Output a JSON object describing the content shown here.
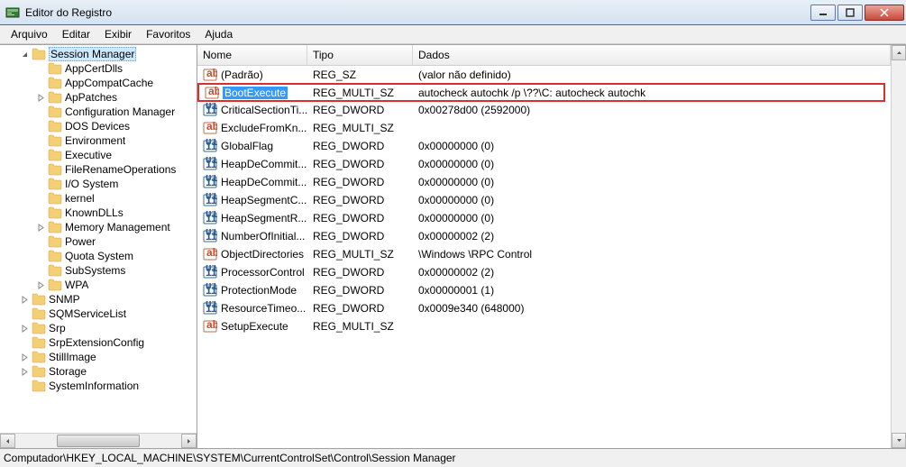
{
  "window": {
    "title": "Editor do Registro"
  },
  "menu": {
    "arquivo": "Arquivo",
    "editar": "Editar",
    "exibir": "Exibir",
    "favoritos": "Favoritos",
    "ajuda": "Ajuda"
  },
  "tree": {
    "items": [
      {
        "label": "Session Manager",
        "depth": 1,
        "expanded": true,
        "selected": true
      },
      {
        "label": "AppCertDlls",
        "depth": 2
      },
      {
        "label": "AppCompatCache",
        "depth": 2
      },
      {
        "label": "ApPatches",
        "depth": 2,
        "expander": "closed"
      },
      {
        "label": "Configuration Manager",
        "depth": 2
      },
      {
        "label": "DOS Devices",
        "depth": 2
      },
      {
        "label": "Environment",
        "depth": 2
      },
      {
        "label": "Executive",
        "depth": 2
      },
      {
        "label": "FileRenameOperations",
        "depth": 2
      },
      {
        "label": "I/O System",
        "depth": 2
      },
      {
        "label": "kernel",
        "depth": 2
      },
      {
        "label": "KnownDLLs",
        "depth": 2
      },
      {
        "label": "Memory Management",
        "depth": 2,
        "expander": "closed"
      },
      {
        "label": "Power",
        "depth": 2
      },
      {
        "label": "Quota System",
        "depth": 2
      },
      {
        "label": "SubSystems",
        "depth": 2
      },
      {
        "label": "WPA",
        "depth": 2,
        "expander": "closed"
      },
      {
        "label": "SNMP",
        "depth": 1,
        "expander": "closed"
      },
      {
        "label": "SQMServiceList",
        "depth": 1
      },
      {
        "label": "Srp",
        "depth": 1,
        "expander": "closed"
      },
      {
        "label": "SrpExtensionConfig",
        "depth": 1
      },
      {
        "label": "StillImage",
        "depth": 1,
        "expander": "closed"
      },
      {
        "label": "Storage",
        "depth": 1,
        "expander": "closed"
      },
      {
        "label": "SystemInformation",
        "depth": 1
      }
    ]
  },
  "list": {
    "columns": {
      "name": "Nome",
      "type": "Tipo",
      "data": "Dados"
    },
    "rows": [
      {
        "kind": "sz",
        "name": "(Padrão)",
        "type": "REG_SZ",
        "data": "(valor não definido)"
      },
      {
        "kind": "sz",
        "name": "BootExecute",
        "type": "REG_MULTI_SZ",
        "data": "autocheck autochk /p \\??\\C: autocheck autochk",
        "selected": true,
        "highlighted": true
      },
      {
        "kind": "dw",
        "name": "CriticalSectionTi...",
        "type": "REG_DWORD",
        "data": "0x00278d00 (2592000)"
      },
      {
        "kind": "sz",
        "name": "ExcludeFromKn...",
        "type": "REG_MULTI_SZ",
        "data": ""
      },
      {
        "kind": "dw",
        "name": "GlobalFlag",
        "type": "REG_DWORD",
        "data": "0x00000000 (0)"
      },
      {
        "kind": "dw",
        "name": "HeapDeCommit...",
        "type": "REG_DWORD",
        "data": "0x00000000 (0)"
      },
      {
        "kind": "dw",
        "name": "HeapDeCommit...",
        "type": "REG_DWORD",
        "data": "0x00000000 (0)"
      },
      {
        "kind": "dw",
        "name": "HeapSegmentC...",
        "type": "REG_DWORD",
        "data": "0x00000000 (0)"
      },
      {
        "kind": "dw",
        "name": "HeapSegmentR...",
        "type": "REG_DWORD",
        "data": "0x00000000 (0)"
      },
      {
        "kind": "dw",
        "name": "NumberOfInitial...",
        "type": "REG_DWORD",
        "data": "0x00000002 (2)"
      },
      {
        "kind": "sz",
        "name": "ObjectDirectories",
        "type": "REG_MULTI_SZ",
        "data": "\\Windows \\RPC Control"
      },
      {
        "kind": "dw",
        "name": "ProcessorControl",
        "type": "REG_DWORD",
        "data": "0x00000002 (2)"
      },
      {
        "kind": "dw",
        "name": "ProtectionMode",
        "type": "REG_DWORD",
        "data": "0x00000001 (1)"
      },
      {
        "kind": "dw",
        "name": "ResourceTimeo...",
        "type": "REG_DWORD",
        "data": "0x0009e340 (648000)"
      },
      {
        "kind": "sz",
        "name": "SetupExecute",
        "type": "REG_MULTI_SZ",
        "data": ""
      }
    ]
  },
  "statusbar": {
    "path": "Computador\\HKEY_LOCAL_MACHINE\\SYSTEM\\CurrentControlSet\\Control\\Session Manager"
  }
}
